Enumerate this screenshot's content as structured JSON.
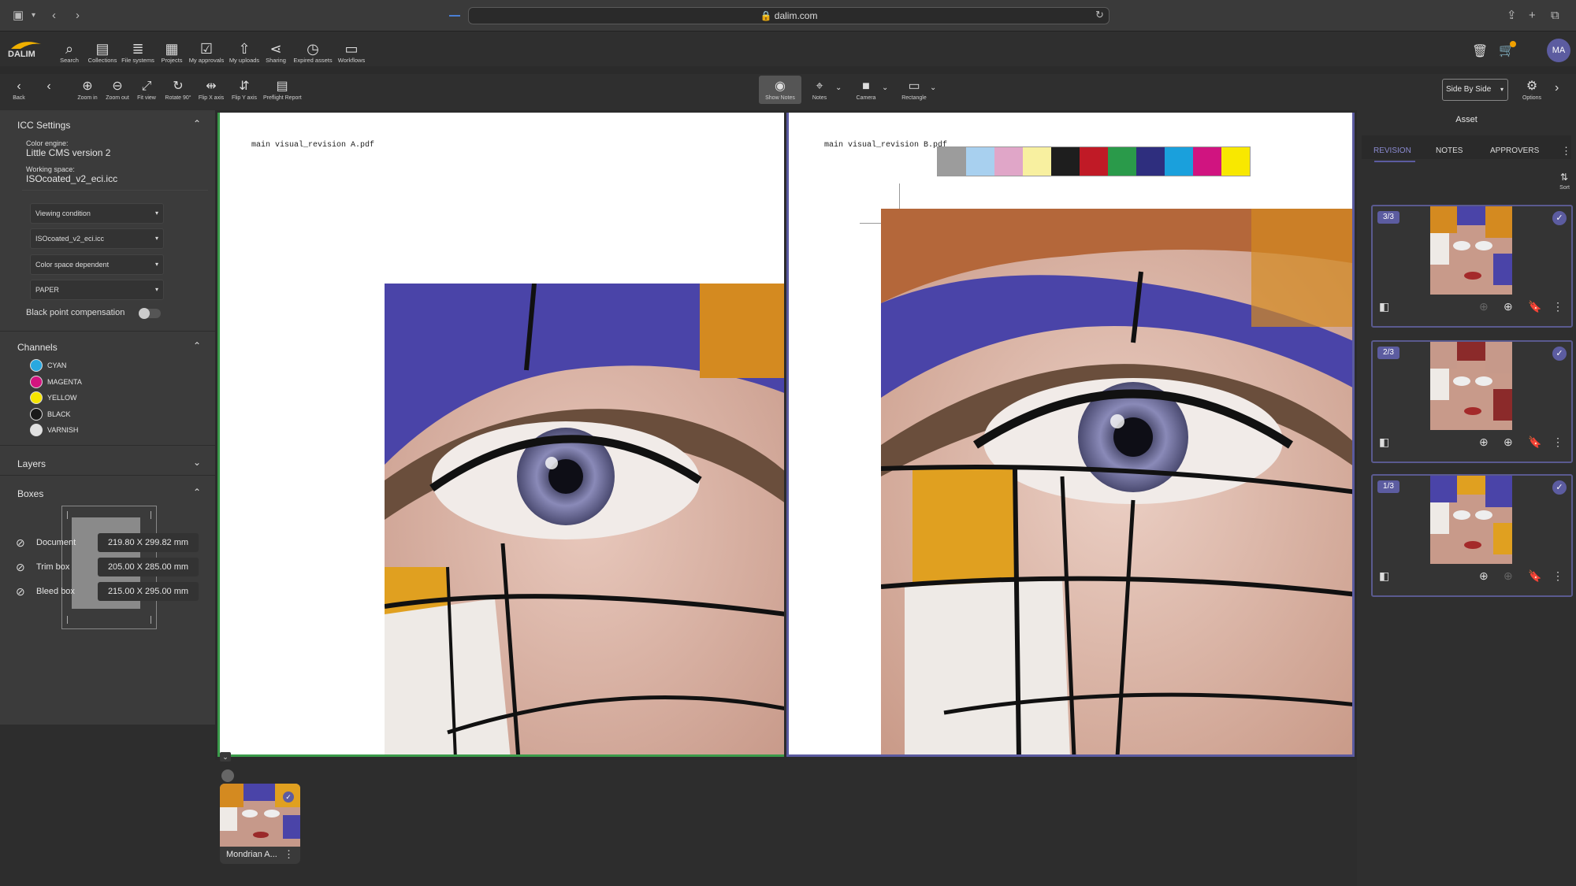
{
  "browser": {
    "url": "dalim.com"
  },
  "nav": {
    "items": [
      {
        "label": "Search",
        "icon": "search-icon"
      },
      {
        "label": "Collections",
        "icon": "collections-icon"
      },
      {
        "label": "File systems",
        "icon": "database-icon"
      },
      {
        "label": "Projects",
        "icon": "briefcase-icon"
      },
      {
        "label": "My approvals",
        "icon": "checklist-icon"
      },
      {
        "label": "My uploads",
        "icon": "upload-icon"
      },
      {
        "label": "Sharing",
        "icon": "share-icon"
      },
      {
        "label": "Expired assets",
        "icon": "clock-icon"
      },
      {
        "label": "Workflows",
        "icon": "monitor-icon"
      }
    ],
    "user_initials": "MA"
  },
  "toolbar": {
    "back_label": "Back",
    "tools": [
      {
        "label": "Zoom in"
      },
      {
        "label": "Zoom out"
      },
      {
        "label": "Fit view"
      },
      {
        "label": "Rotate 90°"
      },
      {
        "label": "Flip X axis"
      },
      {
        "label": "Flip Y axis"
      },
      {
        "label": "Preflight Report"
      }
    ],
    "center_tools": [
      {
        "label": "Show Notes"
      },
      {
        "label": "Notes"
      },
      {
        "label": "Camera"
      },
      {
        "label": "Rectangle"
      }
    ],
    "view_mode": "Side By Side",
    "options_label": "Options"
  },
  "icc": {
    "title": "ICC Settings",
    "engine_label": "Color engine:",
    "engine_value": "Little CMS version 2",
    "space_label": "Working space:",
    "space_value": "ISOcoated_v2_eci.icc",
    "selects": [
      "Viewing condition",
      "ISOcoated_v2_eci.icc",
      "Color space dependent",
      "PAPER"
    ],
    "bpc_label": "Black point compensation"
  },
  "channels": {
    "title": "Channels",
    "items": [
      {
        "name": "CYAN",
        "color": "#29a8e0"
      },
      {
        "name": "MAGENTA",
        "color": "#d4147f"
      },
      {
        "name": "YELLOW",
        "color": "#f5e500"
      },
      {
        "name": "BLACK",
        "color": "#1a1a1a"
      },
      {
        "name": "VARNISH",
        "color": "#e0e0e0"
      }
    ]
  },
  "layers": {
    "title": "Layers"
  },
  "boxes": {
    "title": "Boxes",
    "rows": [
      {
        "name": "Document",
        "value": "219.80 X 299.82 mm"
      },
      {
        "name": "Trim box",
        "value": "205.00 X 285.00 mm"
      },
      {
        "name": "Bleed box",
        "value": "215.00 X 295.00 mm"
      }
    ]
  },
  "viewer": {
    "left_file": "main visual_revision A.pdf",
    "right_file": "main visual_revision B.pdf",
    "color_bar": [
      "#9c9c9c",
      "#a8d0ef",
      "#e0a6c8",
      "#f8f0a0",
      "#1e1e1e",
      "#c01a26",
      "#2a9a4a",
      "#2e2e7e",
      "#1aa0dc",
      "#d01480",
      "#f8e800"
    ]
  },
  "film": {
    "item_label": "Mondrian A..."
  },
  "right": {
    "title": "Asset",
    "tabs": [
      "REVISION",
      "NOTES",
      "APPROVERS"
    ],
    "sort_label": "Sort",
    "revisions": [
      {
        "badge": "3/3"
      },
      {
        "badge": "2/3"
      },
      {
        "badge": "1/3"
      }
    ]
  }
}
